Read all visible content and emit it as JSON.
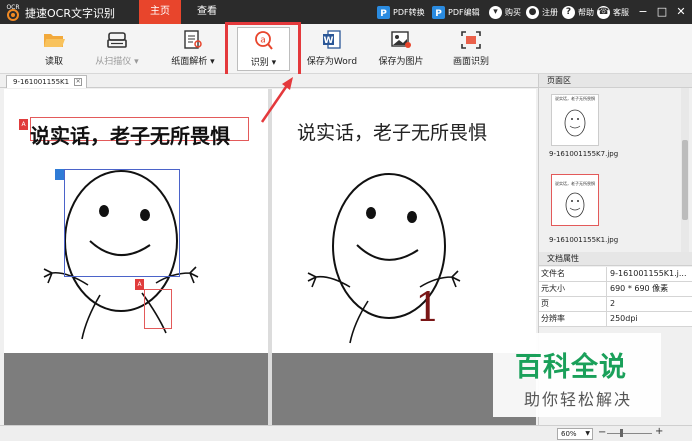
{
  "app": {
    "title": "捷速OCR文字识别",
    "logo_text": "OCR"
  },
  "tabs": [
    {
      "label": "主页",
      "active": true
    },
    {
      "label": "查看",
      "active": false
    }
  ],
  "topright": {
    "pdf_convert": "PDF转换",
    "pdf_edit": "PDF编辑",
    "buy": "购买",
    "register": "注册",
    "help": "帮助",
    "service": "客服"
  },
  "toolbar": {
    "read": "读取",
    "scan": "从扫描仪 ▾",
    "layout": "纸面解析 ▾",
    "recognize": "识别 ▾",
    "save_word": "保存为Word",
    "save_image": "保存为图片",
    "screen_recog": "画面识别"
  },
  "doc_tab": {
    "name": "9-161001155K1"
  },
  "left_pane": {
    "ocr_text": "说实话，老子无所畏惧",
    "marker_a": "A"
  },
  "right_pane": {
    "text": "说实话，老子无所畏惧",
    "number": "1"
  },
  "side": {
    "pages_title": "页面区",
    "thumb_caption": "说实话，老子无所畏惧",
    "thumbs": [
      {
        "name": "9-161001155K7.jpg"
      },
      {
        "name": "9-161001155K1.jpg"
      }
    ],
    "props_title": "文档属性",
    "props": [
      {
        "key": "文件名",
        "value": "9-161001155K1.j..."
      },
      {
        "key": "元大小",
        "value": "690 * 690 像素"
      },
      {
        "key": "页",
        "value": "2"
      },
      {
        "key": "分辨率",
        "value": "250dpi"
      }
    ]
  },
  "status": {
    "zoom": "60%",
    "minus": "−",
    "plus": "+"
  },
  "watermark": {
    "big": "百科全说",
    "small": "助你轻松解决"
  },
  "colors": {
    "titlebar": "#2b2b2b",
    "accent": "#e8452c",
    "highlight": "#e4393c",
    "watermark_green": "#1aa05a"
  }
}
